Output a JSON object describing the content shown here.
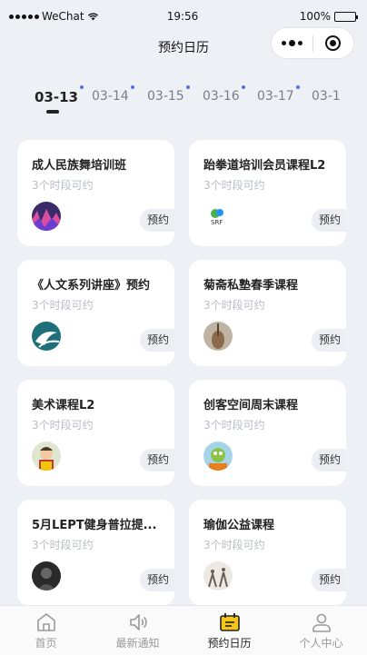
{
  "status_bar": {
    "carrier": "WeChat",
    "time": "19:56",
    "battery": "100%",
    "battery_level": 1.0
  },
  "nav": {
    "title": "预约日历"
  },
  "date_tabs": [
    {
      "label": "03-13",
      "active": true,
      "has_dot": true
    },
    {
      "label": "03-14",
      "active": false,
      "has_dot": true
    },
    {
      "label": "03-15",
      "active": false,
      "has_dot": true
    },
    {
      "label": "03-16",
      "active": false,
      "has_dot": true
    },
    {
      "label": "03-17",
      "active": false,
      "has_dot": true
    },
    {
      "label": "03-1",
      "active": false,
      "has_dot": false
    }
  ],
  "courses": [
    {
      "title": "成人民族舞培训班",
      "slots": "3个时段可约",
      "button": "预约",
      "thumb_icon": "dance-photo"
    },
    {
      "title": "跆拳道培训会员课程L2",
      "slots": "3个时段可约",
      "button": "预约",
      "thumb_icon": "logo-photo"
    },
    {
      "title": "《人文系列讲座》预约",
      "slots": "3个时段可约",
      "button": "预约",
      "thumb_icon": "globe-logo"
    },
    {
      "title": "菊斋私塾春季课程",
      "slots": "3个时段可约",
      "button": "预约",
      "thumb_icon": "guqin-photo"
    },
    {
      "title": "美术课程L2",
      "slots": "3个时段可约",
      "button": "预约",
      "thumb_icon": "child-photo"
    },
    {
      "title": "创客空间周末课程",
      "slots": "3个时段可约",
      "button": "预约",
      "thumb_icon": "cartoon-photo"
    },
    {
      "title": "5月LEPT健身普拉提...",
      "slots": "3个时段可约",
      "button": "预约",
      "thumb_icon": "fitness-photo"
    },
    {
      "title": "瑜伽公益课程",
      "slots": "3个时段可约",
      "button": "预约",
      "thumb_icon": "yoga-photo"
    }
  ],
  "tab_bar": [
    {
      "label": "首页",
      "icon": "home-icon",
      "active": false
    },
    {
      "label": "最新通知",
      "icon": "speaker-icon",
      "active": false
    },
    {
      "label": "预约日历",
      "icon": "calendar-icon",
      "active": true
    },
    {
      "label": "个人中心",
      "icon": "person-icon",
      "active": false
    }
  ],
  "colors": {
    "background": "#edf0f5",
    "accent_dot": "#5a6ee0",
    "calendar_active": "#f5c518"
  }
}
